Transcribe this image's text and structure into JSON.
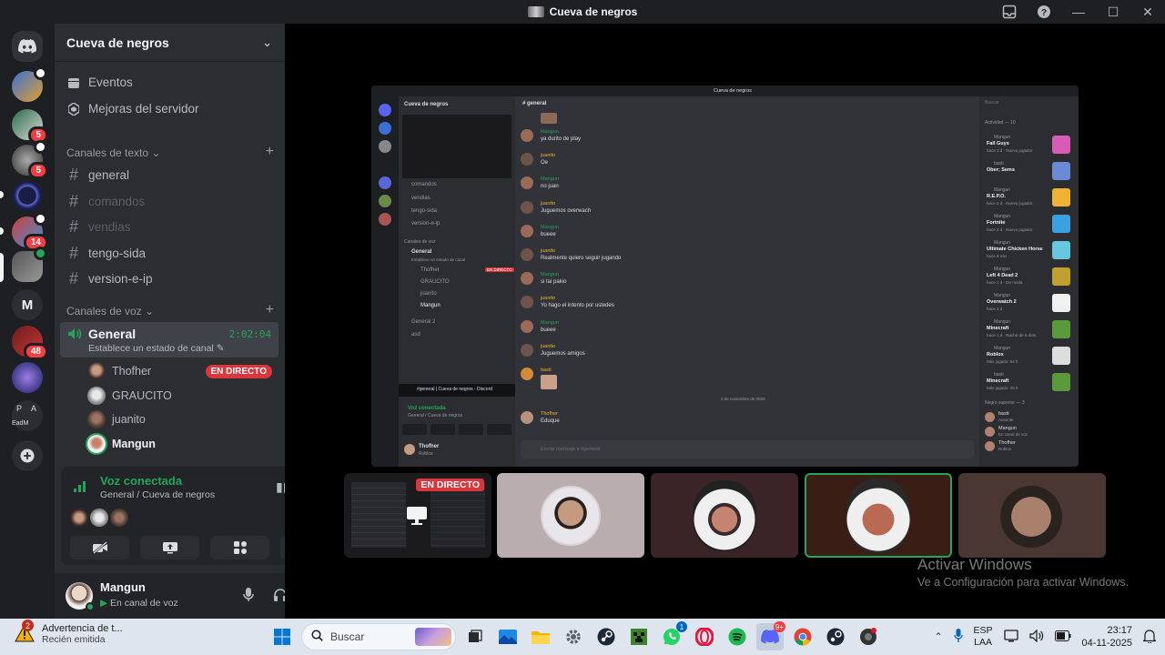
{
  "window": {
    "title": "Cueva de negros"
  },
  "rail": {
    "badges": [
      "5",
      "5",
      "14",
      "48"
    ],
    "text_servers": [
      "M",
      "P",
      "A",
      "EadM"
    ]
  },
  "sidebar": {
    "server_name": "Cueva de negros",
    "nav": [
      {
        "label": "Eventos",
        "icon": "calendar-icon"
      },
      {
        "label": "Mejoras del servidor",
        "icon": "boost-icon"
      }
    ],
    "text_category": "Canales de texto",
    "text_channels": [
      "general",
      "comandos",
      "vendias",
      "tengo-sida",
      "version-e-ip"
    ],
    "voice_category": "Canales de voz",
    "voice_channel": {
      "name": "General",
      "status": "Establece un estado de canal",
      "time": "2:02:04",
      "users": [
        {
          "name": "Thofher",
          "live": "EN DIRECTO"
        },
        {
          "name": "GRAUCITO"
        },
        {
          "name": "juanito"
        },
        {
          "name": "Mangun"
        }
      ]
    }
  },
  "voice_panel": {
    "title": "Voz conectada",
    "subtitle": "General / Cueva de negros"
  },
  "user_panel": {
    "name": "Mangun",
    "status": "En canal de voz"
  },
  "stream": {
    "mini": {
      "server": "Cueva de negros",
      "channel": "general",
      "search": "Buscar",
      "messages": [
        {
          "name": "Mangun",
          "text": "ya durito de play"
        },
        {
          "name": "juanito",
          "text": "Oe"
        },
        {
          "name": "Mangun",
          "text": "no juan"
        },
        {
          "name": "juanito",
          "text": "Juguemos overwach"
        },
        {
          "name": "Mangun",
          "text": "bueee"
        },
        {
          "name": "juanito",
          "text": "Realmente quiero seguir jugando"
        },
        {
          "name": "Mangun",
          "text": "si tai pakio"
        },
        {
          "name": "juanito",
          "text": "Yo hago el intento por ustedes"
        },
        {
          "name": "Mangun",
          "text": "bueee"
        },
        {
          "name": "juanito",
          "text": "Juguemos amigos"
        },
        {
          "name": "basti",
          "text": ""
        },
        {
          "name": "Thofher",
          "text": "Eduque"
        }
      ],
      "date_divider": "3 de noviembre de 2025",
      "composer": "Enviar mensaje a #general",
      "voice_state": "Voz conectada",
      "voice_sub": "General / Cueva de negros",
      "tooltip": "#general | Cueva de negros - Discord",
      "side_channels": [
        "comandos",
        "vendias",
        "tengo-sida",
        "version-e-ip"
      ],
      "side_voice_category": "Canales de voz",
      "side_voice": "General",
      "side_voice_status": "Establece un estado de canal",
      "side_users": [
        "Thofher",
        "GRAUCITO",
        "juanito",
        "Mangun"
      ],
      "side_live": "EN DIRECTO",
      "side_voice2": "General 2",
      "side_voice3": "asd",
      "user": "Thofher",
      "user_status": "Roblox",
      "activity_header": "Actividad — 10",
      "activities": [
        {
          "user": "Mangun",
          "game": "Fall Guys",
          "meta": "hace 3 d · Nuevo jugador"
        },
        {
          "user": "basti",
          "game": "Ober; Sems",
          "meta": ""
        },
        {
          "user": "Mangun",
          "game": "R.E.P.O.",
          "meta": "hace 2 d · Nuevo jugador"
        },
        {
          "user": "Mangun",
          "game": "Fortnite",
          "meta": "hace 2 d · Nuevo jugador"
        },
        {
          "user": "Mangun",
          "game": "Ultimate Chicken Horse",
          "meta": "hace 9 min"
        },
        {
          "user": "Mangun",
          "game": "Left 4 Dead 2",
          "meta": "hace 1 d · De moda"
        },
        {
          "user": "Mangun",
          "game": "Overwatch 2",
          "meta": "hace 2 d"
        },
        {
          "user": "Mangun",
          "game": "Minecraft",
          "meta": "hace 1 d · Racha de 6 días"
        },
        {
          "user": "Mangun",
          "game": "Roblox",
          "meta": "Más jugado: 84 h"
        },
        {
          "user": "basti",
          "game": "Minecraft",
          "meta": "Más jugado: 35 h"
        }
      ],
      "members_header": "Negro superior — 3",
      "members": [
        {
          "name": "basti",
          "status": "Ausente"
        },
        {
          "name": "Mangun",
          "status": "En canal de voz"
        },
        {
          "name": "Thofher",
          "status": "Roblox"
        }
      ]
    },
    "tile_live": "EN DIRECTO"
  },
  "watermark": {
    "title": "Activar Windows",
    "subtitle": "Ve a Configuración para activar Windows."
  },
  "taskbar": {
    "notification_count": "2",
    "notification_title": "Advertencia de t...",
    "notification_sub": "Recién emitida",
    "search_placeholder": "Buscar",
    "whatsapp_badge": "1",
    "discord_badge": "9+",
    "lang": "ESP",
    "lang_sub": "LAA",
    "time": "23:17",
    "date": "04-11-2025"
  },
  "colors": {
    "accent_green": "#23a55a",
    "live_red": "#da373c",
    "badge_red": "#f23f43"
  }
}
